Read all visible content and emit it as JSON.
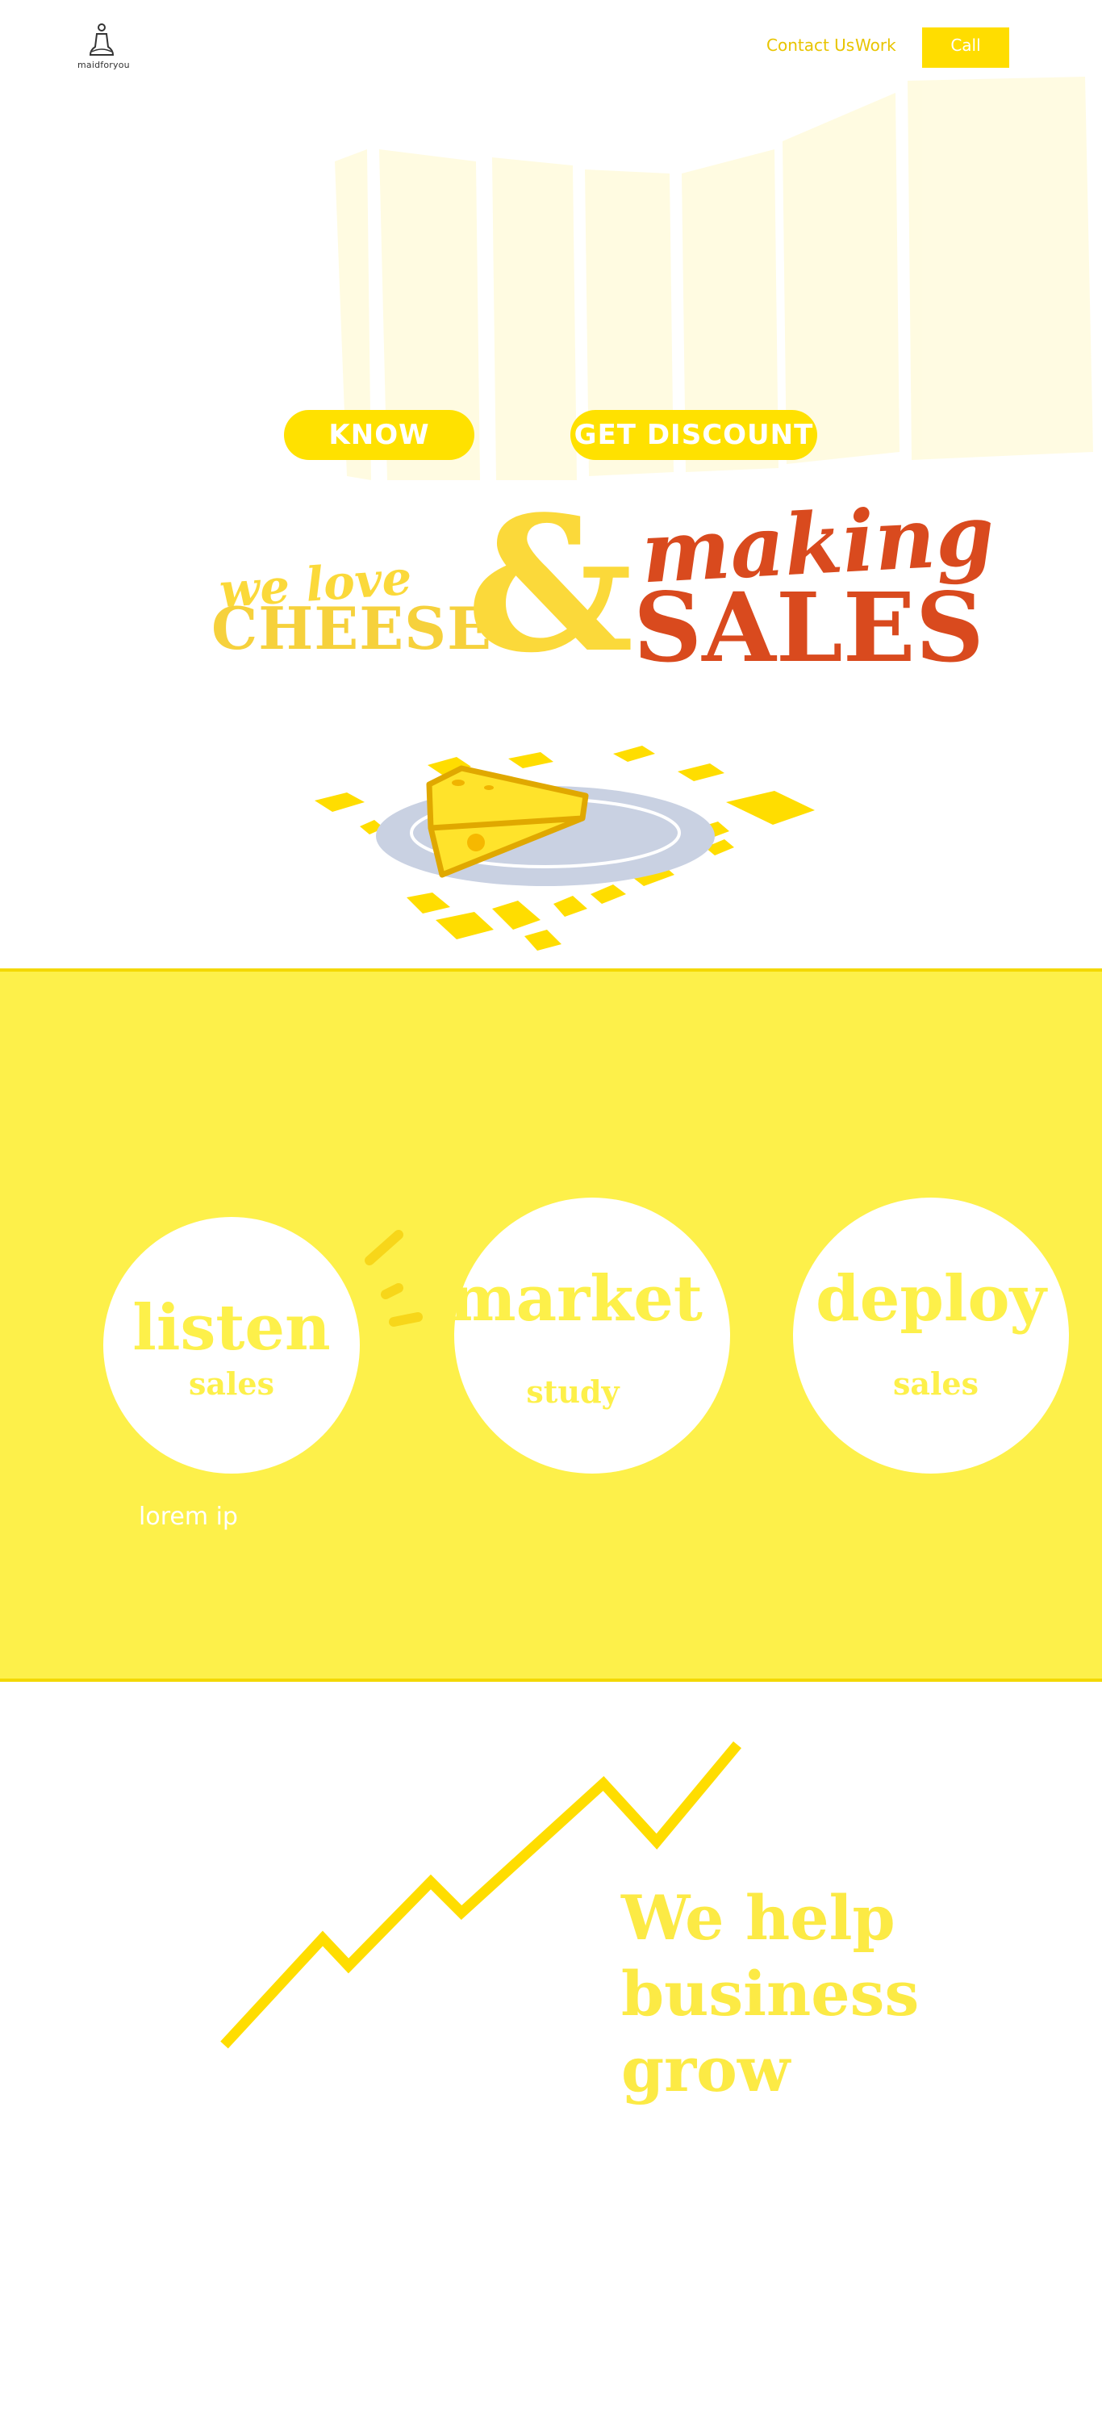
{
  "header": {
    "logo_text": "maidforyou",
    "nav": {
      "contact": "Contact Us",
      "work": "Work"
    },
    "call_label": "Call"
  },
  "hero": {
    "know_label": "KNOW",
    "discount_label": "GET DISCOUNT"
  },
  "slogan": {
    "we_love": "we love",
    "cheese": "CHEESE",
    "ampersand": "&",
    "making": "making",
    "sales": "SALES"
  },
  "steps": [
    {
      "title": "listen",
      "subtitle": "sales"
    },
    {
      "title": "market",
      "subtitle": "study"
    },
    {
      "title": "deploy",
      "subtitle": "sales"
    }
  ],
  "band_text": "lorem ip",
  "growth": {
    "line1": "We help",
    "line2": "business grow"
  },
  "colors": {
    "brand_yellow": "#ffdd00",
    "band_yellow": "#fdf04a",
    "sales_red": "#d94a1e",
    "plate": "#c8d0e0"
  },
  "icons": [
    "bell-logo-icon",
    "cheese-plate-illustration",
    "growth-line-icon",
    "motion-dash-icon"
  ]
}
